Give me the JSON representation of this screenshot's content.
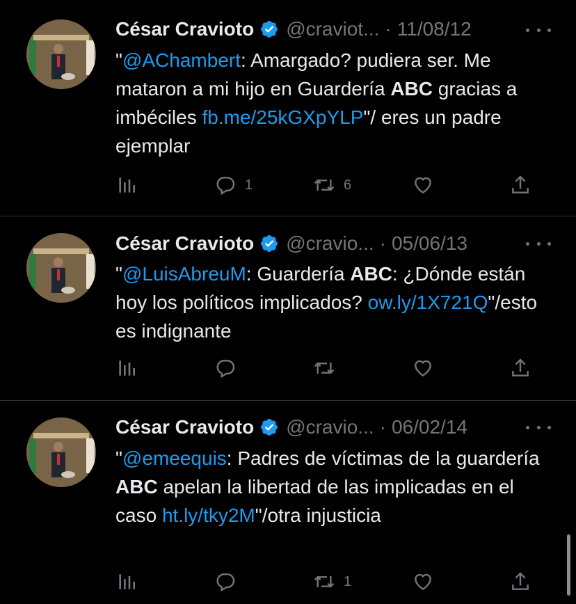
{
  "tweets": [
    {
      "name": "César Cravioto",
      "handle": "@craviot...",
      "sep": "·",
      "date": "11/08/12",
      "quote_open": "\"",
      "mention": "@AChambert",
      "text1": ": Amargado? pudiera ser. Me mataron a mi hijo en Guardería ",
      "bold": "ABC",
      "text2": " gracias a imbéciles ",
      "link": "fb.me/25kGXpYLP",
      "text3": "\"/ eres un padre ejemplar",
      "replies": "1",
      "retweets": "6",
      "likes": ""
    },
    {
      "name": "César Cravioto",
      "handle": "@cravio...",
      "sep": "·",
      "date": "05/06/13",
      "quote_open": "\"",
      "mention": "@LuisAbreuM",
      "text1": ": Guardería ",
      "bold": "ABC",
      "text2": ": ¿Dónde están hoy los políticos implicados? ",
      "link": "ow.ly/1X721Q",
      "text3": "\"/esto es indignante",
      "replies": "",
      "retweets": "",
      "likes": ""
    },
    {
      "name": "César Cravioto",
      "handle": "@cravio...",
      "sep": "·",
      "date": "06/02/14",
      "quote_open": "\"",
      "mention": "@emeequis",
      "text1": ": Padres de víctimas de la guardería ",
      "bold": "ABC",
      "text2": " apelan la libertad de las implicadas en el caso ",
      "link": "ht.ly/tky2M",
      "text3": "\"/otra injusticia",
      "replies": "",
      "retweets": "1",
      "likes": ""
    }
  ],
  "colors": {
    "background": "#000000",
    "link": "#1d9bf0",
    "muted": "#71767b",
    "verified": "#1d9bf0"
  },
  "icons": [
    "views-icon",
    "reply-icon",
    "retweet-icon",
    "like-icon",
    "share-icon",
    "verified-badge-icon",
    "more-icon"
  ]
}
